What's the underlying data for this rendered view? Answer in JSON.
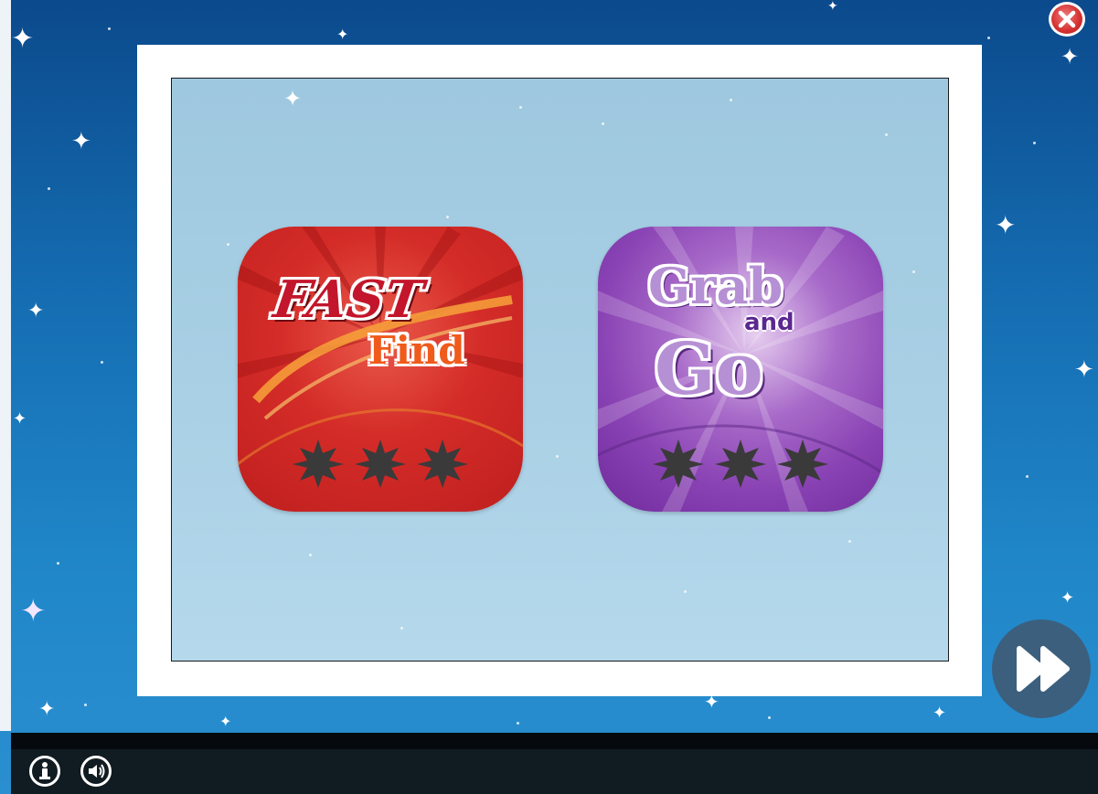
{
  "window": {
    "close_icon": "close-x-icon",
    "accent_background": "#1a78bf",
    "frame_color": "#ffffff"
  },
  "games": [
    {
      "id": "fast-find",
      "title_line1": "FAST",
      "title_line2": "Find",
      "tile_color": "#d42c28",
      "title_color": "#c3152b",
      "subtitle_color": "#f05a1a",
      "stars_earned": 0,
      "stars_total": 3
    },
    {
      "id": "grab-and-go",
      "title_line1": "Grab",
      "title_line2": "and",
      "title_line3": "Go",
      "tile_color": "#8a43b4",
      "title_color": "#b690d4",
      "stars_earned": 0,
      "stars_total": 3
    }
  ],
  "navigation": {
    "next_icon": "fast-forward-icon",
    "next_button_color": "#3c5f7e"
  },
  "toolbar": {
    "info_icon": "info-icon",
    "sound_icon": "speaker-icon",
    "bar_color": "#111b22"
  }
}
